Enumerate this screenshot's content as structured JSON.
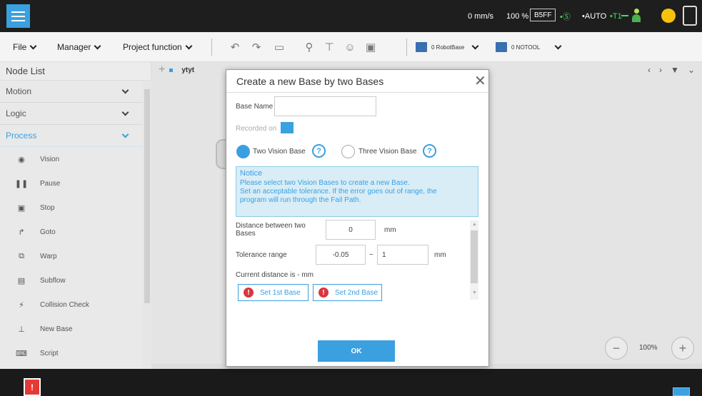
{
  "statusbar": {
    "speed": "0 mm/s",
    "speed_percent": "100 %",
    "ip_suffix": "B5FF",
    "service": "•Ⓢ",
    "mode": "•AUTO",
    "task": "•T1"
  },
  "menubar": {
    "file": "File",
    "manager": "Manager",
    "project_function": "Project function"
  },
  "toolbar": {
    "base_select": "0 RobotBase",
    "tool_select": "0 NOTOOL"
  },
  "node_list": {
    "title": "Node List",
    "sections": [
      "Motion",
      "Logic",
      "Process"
    ],
    "process_items": [
      "Vision",
      "Pause",
      "Stop",
      "Goto",
      "Warp",
      "Subflow",
      "Collision Check",
      "New Base",
      "Script"
    ]
  },
  "canvas": {
    "tab_name": "ytyt",
    "zoom": "100%"
  },
  "dialog": {
    "title": "Create a new Base by two Bases",
    "base_name_label": "Base Name",
    "base_name_value": "",
    "recorded_on_label": "Recorded on",
    "two_vision_label": "Two Vision Base",
    "three_vision_label": "Three Vision Base",
    "help_glyph": "?",
    "notice_title": "Notice",
    "notice_lines": [
      "Please select two Vision Bases to create a new Base.",
      "Set an acceptable tolerance. If the error goes out of range, the",
      "program will run through the Fail Path."
    ],
    "distance_label_line1": "Distance between two",
    "distance_label_line2": "Bases",
    "distance_value": "0",
    "unit": "mm",
    "tolerance_label": "Tolerance range",
    "tolerance_min": "-0.05",
    "tolerance_sep": "~",
    "tolerance_max": "1",
    "current_distance": "Current distance is - mm",
    "set_first": "Set 1st Base",
    "set_second": "Set 2nd Base",
    "alert_glyph": "!",
    "ok": "OK"
  },
  "colors": {
    "accent": "#3aa0e0",
    "topbar": "#1e1e1e",
    "alert": "#d9363e"
  }
}
